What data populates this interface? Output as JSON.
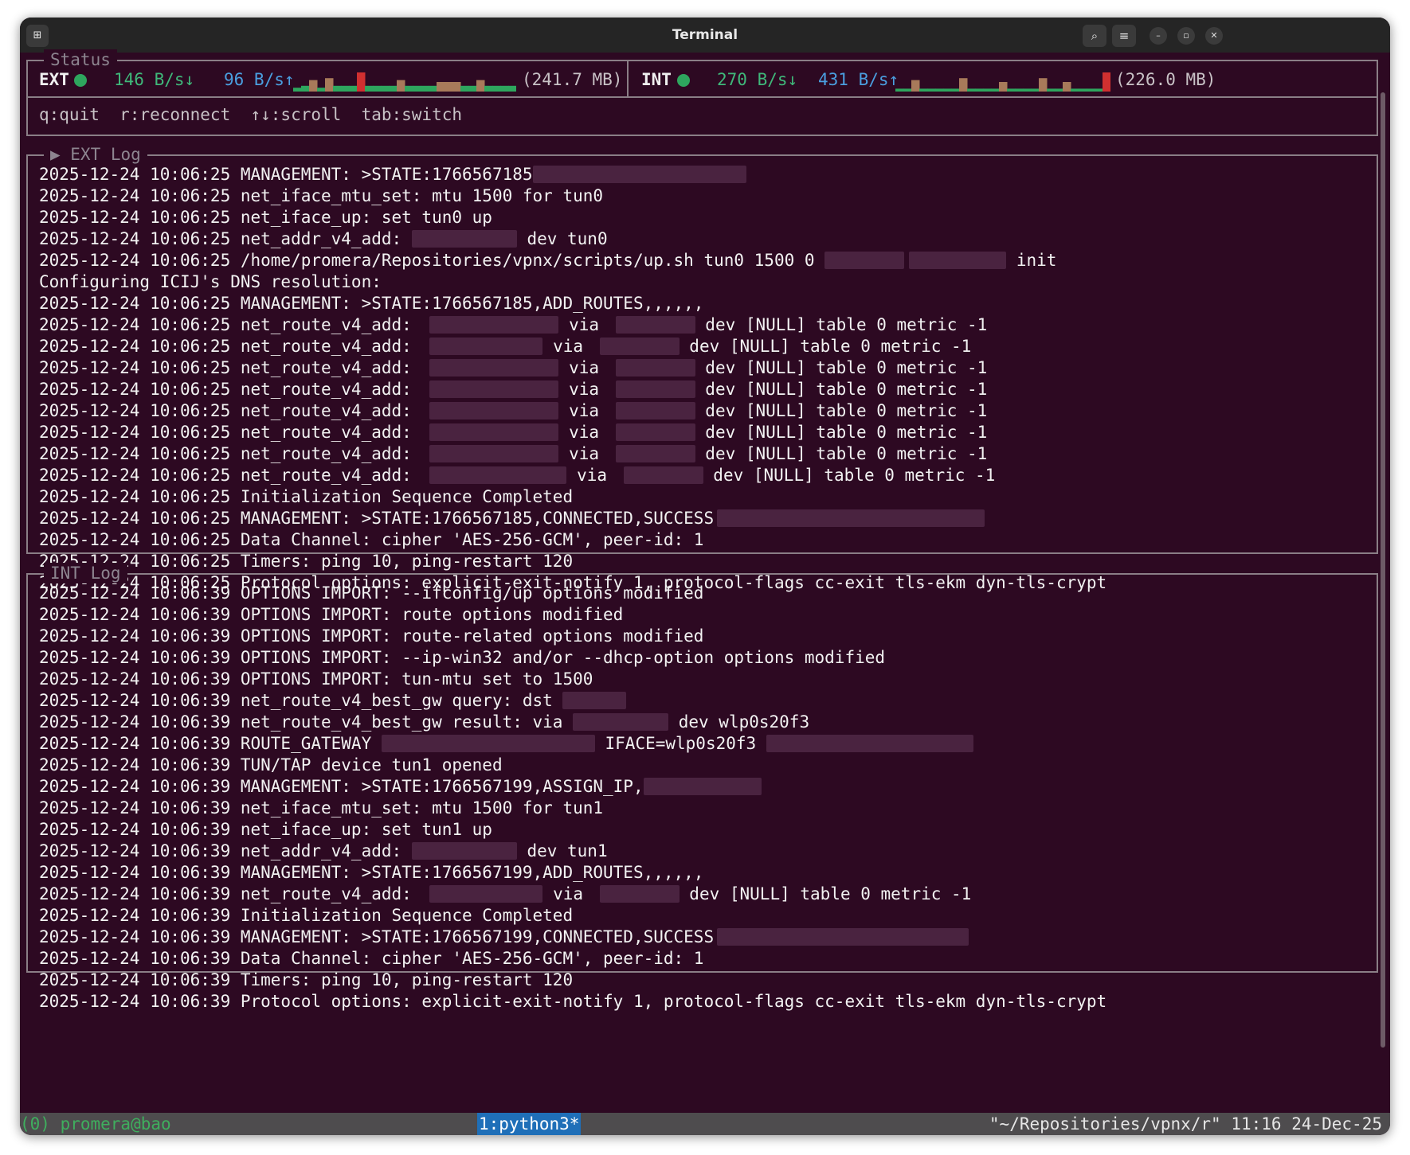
{
  "window": {
    "title": "Terminal"
  },
  "status": {
    "legend": "Status",
    "ext": {
      "label": "EXT",
      "down": "146 B/s↓",
      "up": "96 B/s↑",
      "total": "(241.7 MB)"
    },
    "int": {
      "label": "INT",
      "down": "270 B/s↓",
      "up": "431 B/s↑",
      "total": "(226.0 MB)"
    },
    "colors": {
      "ok": "#2ea65e",
      "down": "#3fb87a",
      "up": "#4a9fe0",
      "bar": "#2ea65e",
      "peak": "#a87a5a",
      "max": "#d03030"
    }
  },
  "keys": "q:quit  r:reconnect  ↑↓:scroll  tab:switch",
  "ext_log": {
    "legend": "▶ EXT Log",
    "lines": [
      {
        "t": "2025-12-24 10:06:25 MANAGEMENT: >STATE:1766567185",
        "r": [
          {
            "gap": 0,
            "w": 268
          }
        ]
      },
      {
        "t": "2025-12-24 10:06:25 net_iface_mtu_set: mtu 1500 for tun0"
      },
      {
        "t": "2025-12-24 10:06:25 net_iface_up: set tun0 up"
      },
      {
        "t": "2025-12-24 10:06:25 net_addr_v4_add: ",
        "r": [
          {
            "gap": 0,
            "w": 132
          }
        ],
        "after": " dev tun0"
      },
      {
        "t": "2025-12-24 10:06:25 /home/promera/Repositories/vpnx/scripts/up.sh tun0 1500 0 ",
        "r": [
          {
            "gap": 0,
            "w": 100
          },
          {
            "gap": 6,
            "w": 122
          }
        ],
        "after": " init"
      },
      {
        "t": "Configuring ICIJ's DNS resolution:"
      },
      {
        "t": "2025-12-24 10:06:25 MANAGEMENT: >STATE:1766567185,ADD_ROUTES,,,,,,"
      },
      {
        "t": "2025-12-24 10:06:25 net_route_v4_add: ",
        "r": [
          {
            "gap": 10,
            "w": 162
          }
        ],
        "mid": " via ",
        "r2": 100,
        "after": " dev [NULL] table 0 metric -1"
      },
      {
        "t": "2025-12-24 10:06:25 net_route_v4_add: ",
        "r": [
          {
            "gap": 10,
            "w": 142
          }
        ],
        "mid": " via ",
        "r2": 100,
        "after": " dev [NULL] table 0 metric -1"
      },
      {
        "t": "2025-12-24 10:06:25 net_route_v4_add: ",
        "r": [
          {
            "gap": 10,
            "w": 162
          }
        ],
        "mid": " via ",
        "r2": 100,
        "after": " dev [NULL] table 0 metric -1"
      },
      {
        "t": "2025-12-24 10:06:25 net_route_v4_add: ",
        "r": [
          {
            "gap": 10,
            "w": 162
          }
        ],
        "mid": " via ",
        "r2": 100,
        "after": " dev [NULL] table 0 metric -1"
      },
      {
        "t": "2025-12-24 10:06:25 net_route_v4_add: ",
        "r": [
          {
            "gap": 10,
            "w": 162
          }
        ],
        "mid": " via ",
        "r2": 100,
        "after": " dev [NULL] table 0 metric -1"
      },
      {
        "t": "2025-12-24 10:06:25 net_route_v4_add: ",
        "r": [
          {
            "gap": 10,
            "w": 162
          }
        ],
        "mid": " via ",
        "r2": 100,
        "after": " dev [NULL] table 0 metric -1"
      },
      {
        "t": "2025-12-24 10:06:25 net_route_v4_add: ",
        "r": [
          {
            "gap": 10,
            "w": 162
          }
        ],
        "mid": " via ",
        "r2": 100,
        "after": " dev [NULL] table 0 metric -1"
      },
      {
        "t": "2025-12-24 10:06:25 net_route_v4_add: ",
        "r": [
          {
            "gap": 10,
            "w": 172
          }
        ],
        "mid": " via ",
        "r2": 100,
        "after": " dev [NULL] table 0 metric -1"
      },
      {
        "t": "2025-12-24 10:06:25 Initialization Sequence Completed"
      },
      {
        "t": "2025-12-24 10:06:25 MANAGEMENT: >STATE:1766567185,CONNECTED,SUCCESS",
        "r": [
          {
            "gap": 4,
            "w": 336
          }
        ]
      },
      {
        "t": "2025-12-24 10:06:25 Data Channel: cipher 'AES-256-GCM', peer-id: 1"
      },
      {
        "t": "2025-12-24 10:06:25 Timers: ping 10, ping-restart 120"
      },
      {
        "t": "2025-12-24 10:06:25 Protocol options: explicit-exit-notify 1, protocol-flags cc-exit tls-ekm dyn-tls-crypt"
      }
    ]
  },
  "int_log": {
    "legend": "INT Log",
    "lines": [
      {
        "t": "2025-12-24 10:06:39 OPTIONS IMPORT: --ifconfig/up options modified"
      },
      {
        "t": "2025-12-24 10:06:39 OPTIONS IMPORT: route options modified"
      },
      {
        "t": "2025-12-24 10:06:39 OPTIONS IMPORT: route-related options modified"
      },
      {
        "t": "2025-12-24 10:06:39 OPTIONS IMPORT: --ip-win32 and/or --dhcp-option options modified"
      },
      {
        "t": "2025-12-24 10:06:39 OPTIONS IMPORT: tun-mtu set to 1500"
      },
      {
        "t": "2025-12-24 10:06:39 net_route_v4_best_gw query: dst ",
        "r": [
          {
            "gap": 0,
            "w": 80
          }
        ]
      },
      {
        "t": "2025-12-24 10:06:39 net_route_v4_best_gw result: via ",
        "r": [
          {
            "gap": 0,
            "w": 120
          }
        ],
        "after": " dev wlp0s20f3"
      },
      {
        "t": "2025-12-24 10:06:39 ROUTE_GATEWAY ",
        "r": [
          {
            "gap": 0,
            "w": 268
          }
        ],
        "after": " IFACE=wlp0s20f3 ",
        "r2": 260
      },
      {
        "t": "2025-12-24 10:06:39 TUN/TAP device tun1 opened"
      },
      {
        "t": "2025-12-24 10:06:39 MANAGEMENT: >STATE:1766567199,ASSIGN_IP,",
        "r": [
          {
            "gap": 0,
            "w": 148
          }
        ]
      },
      {
        "t": "2025-12-24 10:06:39 net_iface_mtu_set: mtu 1500 for tun1"
      },
      {
        "t": "2025-12-24 10:06:39 net_iface_up: set tun1 up"
      },
      {
        "t": "2025-12-24 10:06:39 net_addr_v4_add: ",
        "r": [
          {
            "gap": 0,
            "w": 132
          }
        ],
        "after": " dev tun1"
      },
      {
        "t": "2025-12-24 10:06:39 MANAGEMENT: >STATE:1766567199,ADD_ROUTES,,,,,,"
      },
      {
        "t": "2025-12-24 10:06:39 net_route_v4_add: ",
        "r": [
          {
            "gap": 10,
            "w": 142
          }
        ],
        "mid": " via ",
        "r2": 100,
        "after": " dev [NULL] table 0 metric -1"
      },
      {
        "t": "2025-12-24 10:06:39 Initialization Sequence Completed"
      },
      {
        "t": "2025-12-24 10:06:39 MANAGEMENT: >STATE:1766567199,CONNECTED,SUCCESS",
        "r": [
          {
            "gap": 4,
            "w": 316
          }
        ]
      },
      {
        "t": "2025-12-24 10:06:39 Data Channel: cipher 'AES-256-GCM', peer-id: 1"
      },
      {
        "t": "2025-12-24 10:06:39 Timers: ping 10, ping-restart 120"
      },
      {
        "t": "2025-12-24 10:06:39 Protocol options: explicit-exit-notify 1, protocol-flags cc-exit tls-ekm dyn-tls-crypt"
      }
    ]
  },
  "statusbar": {
    "session": "(0) promera@bao",
    "window": "1:python3*",
    "right": "\"~/Repositories/vpnx/r\" 11:16 24-Dec-25"
  }
}
